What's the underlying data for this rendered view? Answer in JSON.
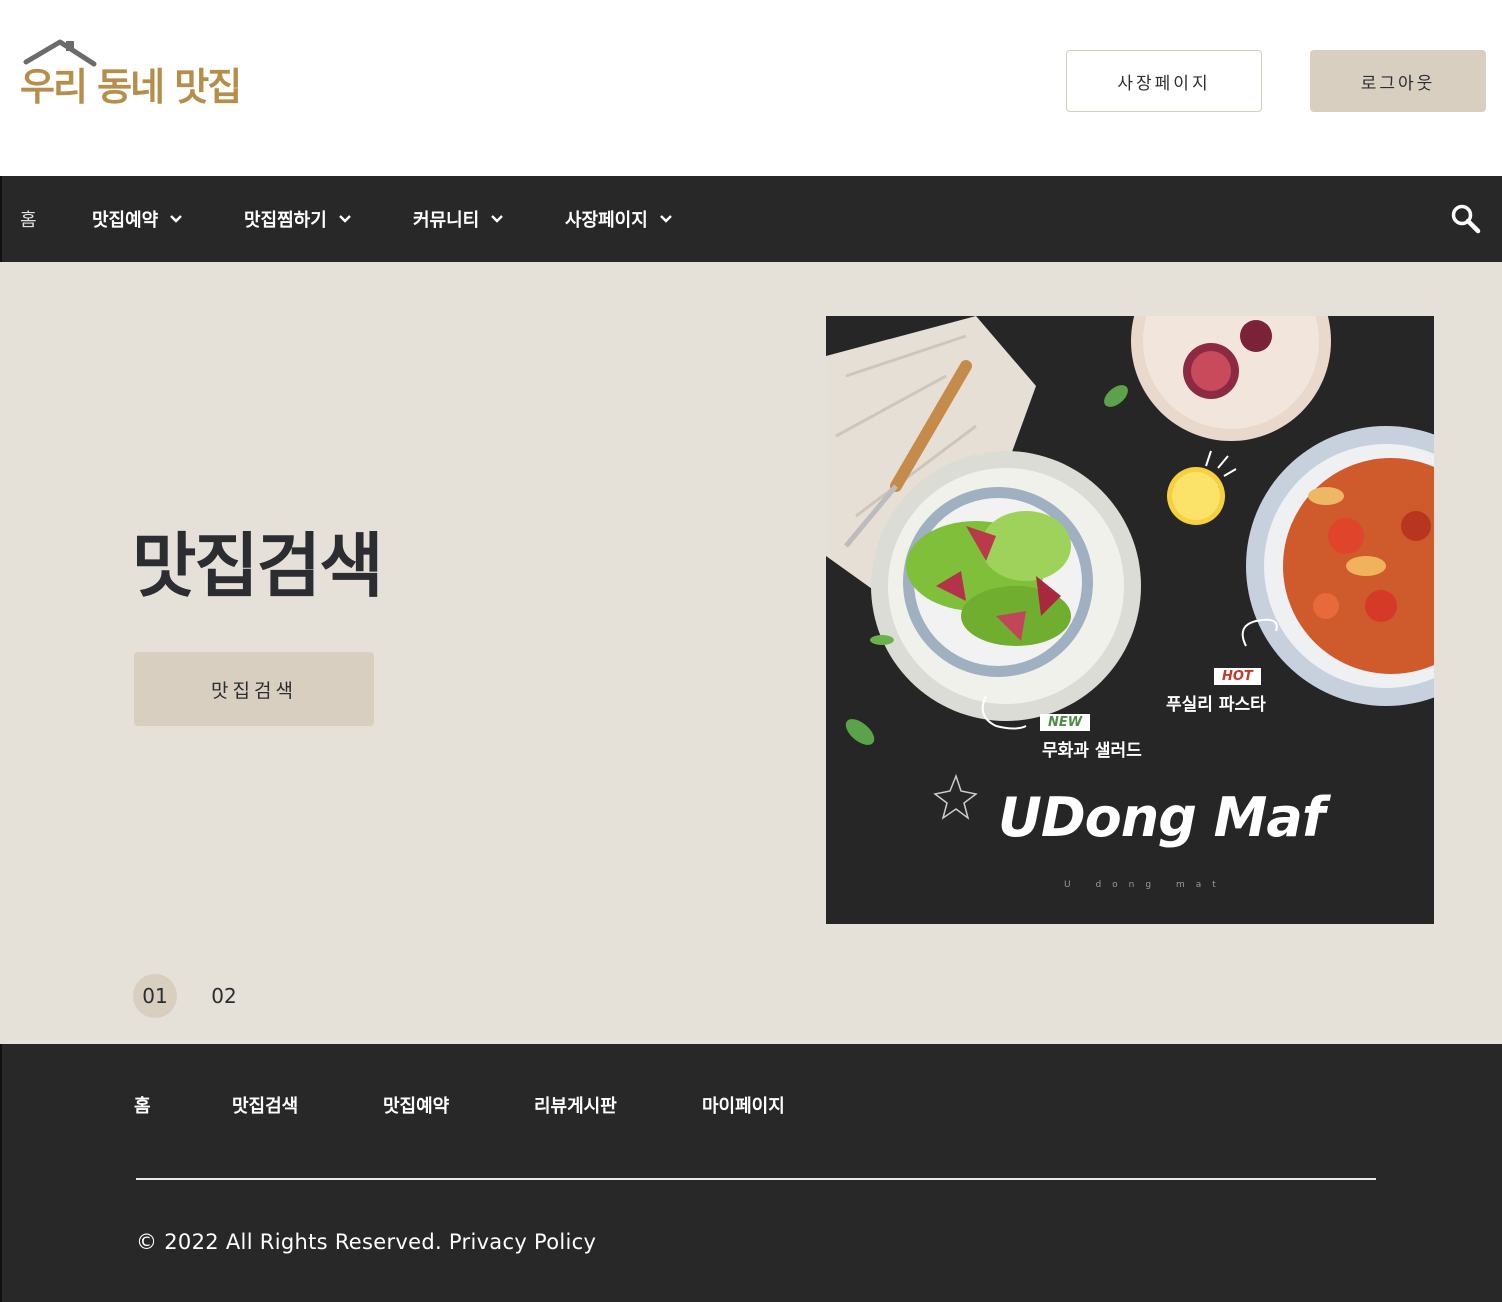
{
  "header": {
    "logo_text": "우리 동네 맛집",
    "owner_button": "사장페이지",
    "logout_button": "로그아웃"
  },
  "nav": {
    "items": [
      {
        "label": "홈",
        "has_dropdown": false
      },
      {
        "label": "맛집예약",
        "has_dropdown": true
      },
      {
        "label": "맛집찜하기",
        "has_dropdown": true
      },
      {
        "label": "커뮤니티",
        "has_dropdown": true
      },
      {
        "label": "사장페이지",
        "has_dropdown": true
      }
    ],
    "search_icon": "search-icon"
  },
  "hero": {
    "title": "맛집검색",
    "button_label": "맛집검색",
    "pager": [
      "01",
      "02"
    ],
    "active_page": "01",
    "image": {
      "hot_tag": "HOT",
      "hot_label": "푸실리 파스타",
      "new_tag": "NEW",
      "new_label": "무화과 샐러드",
      "brand": "UDong Maf",
      "brand_sub": "U dong mat"
    }
  },
  "footer": {
    "links": [
      "홈",
      "맛집검색",
      "맛집예약",
      "리뷰게시판",
      "마이페이지"
    ],
    "copyright": "© 2022 All Rights Reserved. Privacy Policy"
  },
  "colors": {
    "logo_gold": "#b58e4a",
    "nav_bg": "#282828",
    "hero_bg": "#e5e0d8",
    "accent_beige": "#d9cfc1"
  }
}
